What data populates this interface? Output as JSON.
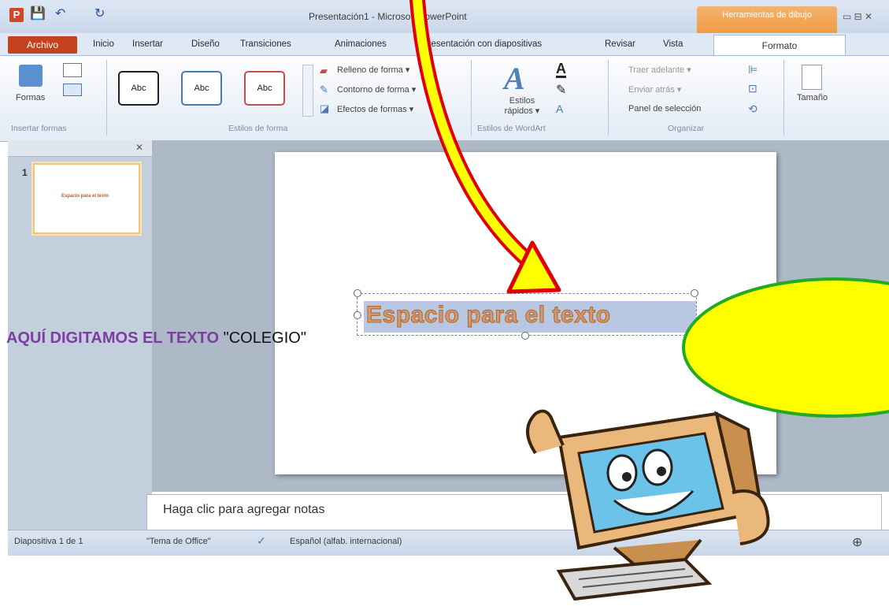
{
  "titlebar": {
    "qat_save": "💾",
    "qat_undo": "↶",
    "qat_redo": "↻",
    "title": "Presentación1 - Microsoft PowerPoint",
    "context_tab": "Herramientas de dibujo",
    "window_controls": "▭ ⊟ ✕"
  },
  "tabs": [
    "Archivo",
    "Inicio",
    "Insertar",
    "Diseño",
    "Transiciones",
    "Animaciones",
    "Presentación con diapositivas",
    "Revisar",
    "Vista"
  ],
  "active_tab": "Formato",
  "ribbon": {
    "insert_shapes": {
      "label": "Insertar formas",
      "formas": "Formas"
    },
    "shape_styles": {
      "label": "Estilos de forma",
      "thumbs": [
        "Abc",
        "Abc",
        "Abc"
      ],
      "fill": "Relleno de forma ▾",
      "outline": "Contorno de forma ▾",
      "effects": "Efectos de formas ▾"
    },
    "wordart": {
      "label": "Estilos de WordArt",
      "quick": "Estilos rápidos ▾"
    },
    "arrange": {
      "label": "Organizar",
      "bring": "Traer adelante ▾",
      "send": "Enviar atrás ▾",
      "pane": "Panel de selección"
    },
    "size": {
      "label": "Tamaño"
    }
  },
  "slide_panel": {
    "thumb_number": "1",
    "thumb_text": "Espacio para el texto"
  },
  "slide": {
    "textbox_text": "Espacio para el texto"
  },
  "notes": {
    "placeholder": "Haga clic para agregar notas"
  },
  "statusbar": {
    "slide_count": "Diapositiva 1 de 1",
    "theme": "\"Tema de Office\"",
    "language": "Español (alfab. internacional)",
    "zoom_btn": "⊕"
  },
  "annotation": {
    "part1": "AQUÍ DIGITAMOS EL TEXTO",
    "part2": " \"COLEGIO\""
  },
  "colors": {
    "accent": "#c6411d",
    "arrow_fill": "#ffff00",
    "arrow_stroke": "#e00000",
    "bubble": "#ffff00",
    "bubble_border": "#22aa22"
  }
}
